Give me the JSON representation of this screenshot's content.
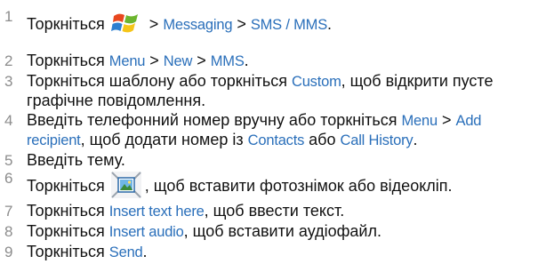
{
  "steps": [
    {
      "num": "1",
      "segments": [
        {
          "text": "Торкніться ",
          "ui": false
        },
        {
          "icon": "windows-start-icon"
        },
        {
          "text": " > ",
          "ui": false
        },
        {
          "text": "Messaging",
          "ui": true
        },
        {
          "text": " > ",
          "ui": false
        },
        {
          "text": "SMS / MMS",
          "ui": true
        },
        {
          "text": ".",
          "ui": false
        }
      ]
    },
    {
      "num": "2",
      "segments": [
        {
          "text": "Торкніться ",
          "ui": false
        },
        {
          "text": "Menu",
          "ui": true
        },
        {
          "text": " > ",
          "ui": false
        },
        {
          "text": "New",
          "ui": true
        },
        {
          "text": " > ",
          "ui": false
        },
        {
          "text": "MMS",
          "ui": true
        },
        {
          "text": ".",
          "ui": false
        }
      ]
    },
    {
      "num": "3",
      "segments": [
        {
          "text": "Торкніться шаблону або торкніться ",
          "ui": false
        },
        {
          "text": "Custom",
          "ui": true
        },
        {
          "text": ", щоб відкрити пусте графічне повідомлення.",
          "ui": false
        }
      ]
    },
    {
      "num": "4",
      "segments": [
        {
          "text": "Введіть телефонний номер вручну або торкніться ",
          "ui": false
        },
        {
          "text": "Menu",
          "ui": true
        },
        {
          "text": " > ",
          "ui": false
        },
        {
          "text": "Add recipient",
          "ui": true
        },
        {
          "text": ", щоб додати номер із ",
          "ui": false
        },
        {
          "text": "Contacts",
          "ui": true
        },
        {
          "text": " або ",
          "ui": false
        },
        {
          "text": "Call History",
          "ui": true
        },
        {
          "text": ".",
          "ui": false
        }
      ]
    },
    {
      "num": "5",
      "segments": [
        {
          "text": "Введіть тему.",
          "ui": false
        }
      ]
    },
    {
      "num": "6",
      "segments": [
        {
          "text": "Торкніться ",
          "ui": false
        },
        {
          "icon": "insert-picture-icon"
        },
        {
          "text": ", щоб вставити фотознімок або відеокліп.",
          "ui": false
        }
      ]
    },
    {
      "num": "7",
      "segments": [
        {
          "text": "Торкніться ",
          "ui": false
        },
        {
          "text": "Insert text here",
          "ui": true
        },
        {
          "text": ", щоб ввести текст.",
          "ui": false
        }
      ]
    },
    {
      "num": "8",
      "segments": [
        {
          "text": "Торкніться ",
          "ui": false
        },
        {
          "text": "Insert audio",
          "ui": true
        },
        {
          "text": ", щоб вставити аудіофайл.",
          "ui": false
        }
      ]
    },
    {
      "num": "9",
      "segments": [
        {
          "text": "Торкніться ",
          "ui": false
        },
        {
          "text": "Send",
          "ui": true
        },
        {
          "text": ".",
          "ui": false
        }
      ]
    }
  ],
  "colors": {
    "ui_term": "#2a6fba",
    "step_number": "#8c8c8c",
    "body_text": "#111111"
  }
}
